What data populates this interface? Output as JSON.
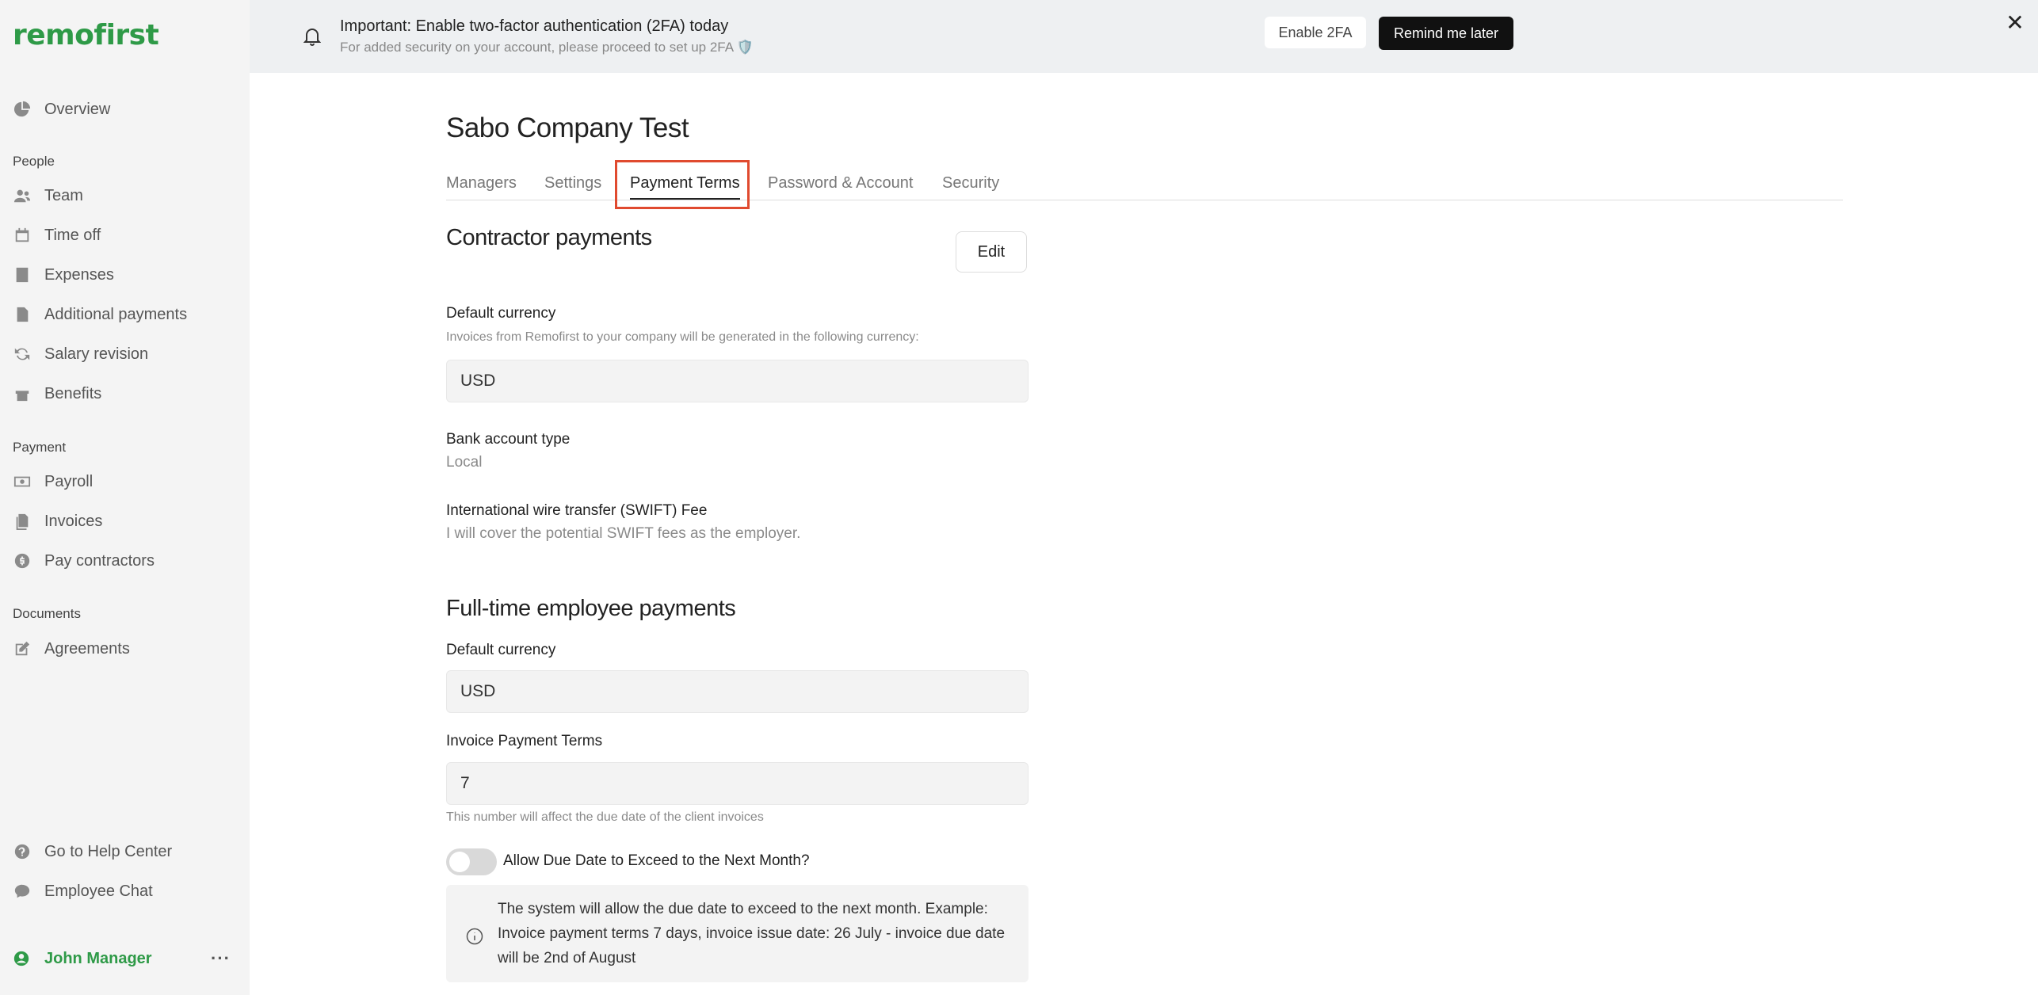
{
  "app": {
    "logo": "remofirst"
  },
  "sidebar": {
    "overview": "Overview",
    "sections": {
      "people": "People",
      "payment": "Payment",
      "documents": "Documents"
    },
    "people_items": [
      "Team",
      "Time off",
      "Expenses",
      "Additional payments",
      "Salary revision",
      "Benefits"
    ],
    "payment_items": [
      "Payroll",
      "Invoices",
      "Pay contractors"
    ],
    "documents_items": [
      "Agreements"
    ],
    "footer_items": [
      "Go to Help Center",
      "Employee Chat"
    ],
    "user": {
      "name": "John Manager",
      "more": "···"
    }
  },
  "banner": {
    "title": "Important: Enable two-factor authentication (2FA) today",
    "subtitle": "For added security on your account, please proceed to set up 2FA 🛡️",
    "enable_label": "Enable 2FA",
    "remind_label": "Remind me later",
    "close": "✕"
  },
  "page": {
    "title": "Sabo Company Test",
    "tabs": [
      "Managers",
      "Settings",
      "Payment Terms",
      "Password & Account",
      "Security"
    ],
    "active_tab": "Payment Terms"
  },
  "contractor": {
    "heading": "Contractor payments",
    "edit_label": "Edit",
    "currency_label": "Default currency",
    "currency_desc": "Invoices from Remofirst to your company will be generated in the following currency:",
    "currency_value": "USD",
    "bank_label": "Bank account type",
    "bank_value": "Local",
    "swift_label": "International wire transfer (SWIFT) Fee",
    "swift_value": "I will cover the potential SWIFT fees as the employer."
  },
  "fulltime": {
    "heading": "Full-time employee payments",
    "currency_label": "Default currency",
    "currency_value": "USD",
    "terms_label": "Invoice Payment Terms",
    "terms_value": "7",
    "terms_desc": "This number will affect the due date of the client invoices",
    "toggle_label": "Allow Due Date to Exceed to the Next Month?",
    "toggle_on": false,
    "info_text": "The system will allow the due date to exceed to the next month. Example: Invoice payment terms 7 days, invoice issue date: 26 July - invoice due date will be 2nd of August"
  },
  "colors": {
    "brand": "#2e9a47",
    "highlight": "#e04a2f",
    "sidebar_bg": "#f4f4f4",
    "banner_bg": "#eef0f2"
  }
}
